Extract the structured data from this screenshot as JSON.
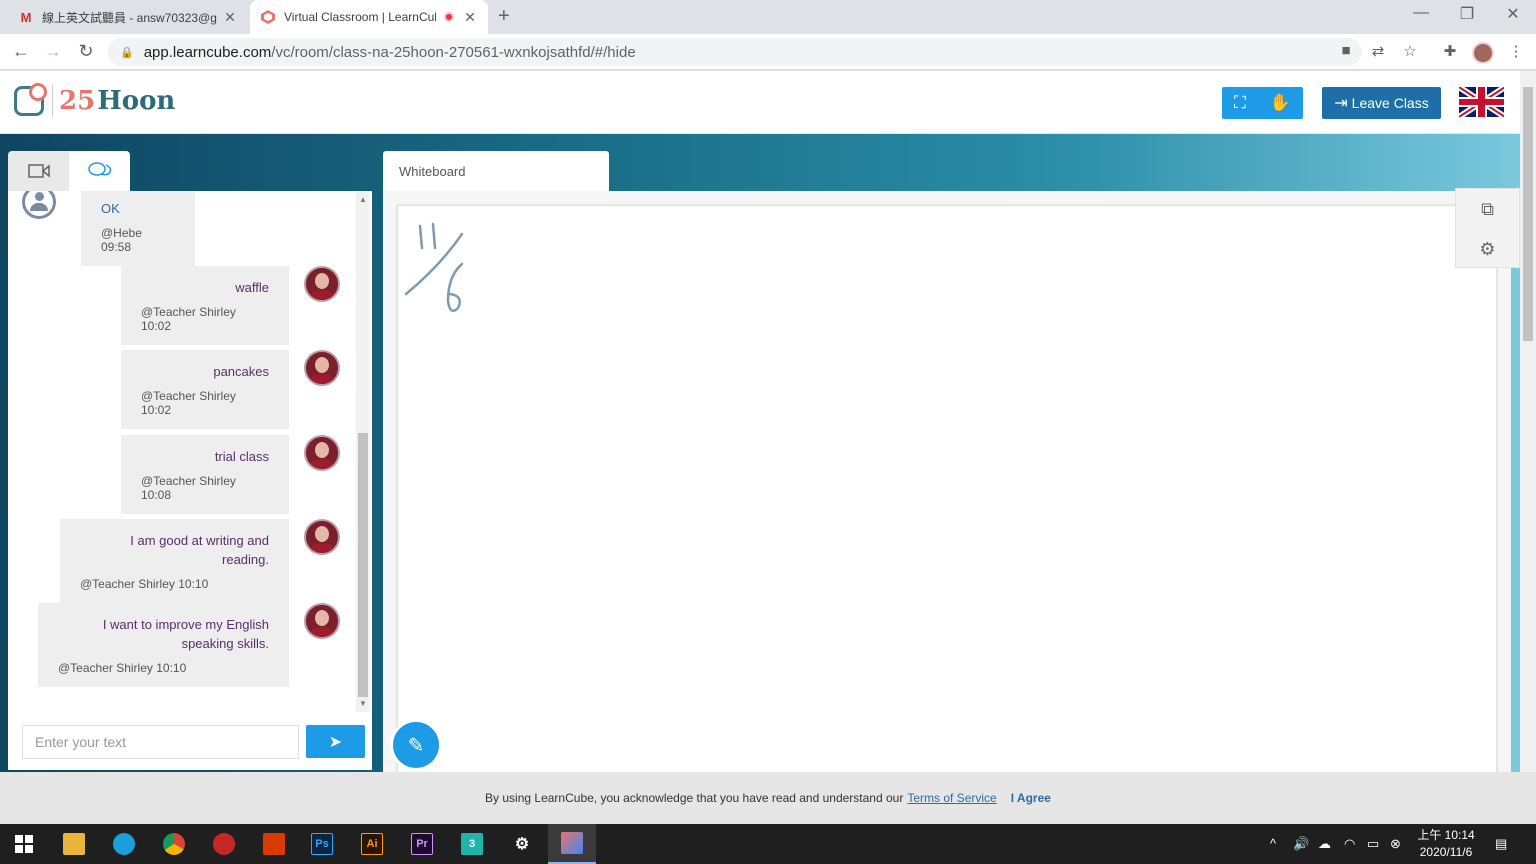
{
  "browser": {
    "tabs": [
      {
        "title": "線上英文試聽員 - answ70323@g",
        "icon": "gmail-icon",
        "active": false
      },
      {
        "title": "Virtual Classroom | LearnCube",
        "icon": "learncube-icon",
        "active": true
      }
    ],
    "url_host": "app.learncube.com",
    "url_path": "/vc/room/class-na-25hoon-270561-wxnkojsathfd/#/hide"
  },
  "app": {
    "logo_num": "25",
    "logo_word": "Hoon",
    "leave_label": "Leave Class",
    "whiteboard_tab": "Whiteboard",
    "chat_placeholder": "Enter your text",
    "messages": [
      {
        "text": "OK",
        "meta": "@Hebe 09:58",
        "from": "student"
      },
      {
        "text": "waffle",
        "meta": "@Teacher Shirley 10:02",
        "from": "teacher"
      },
      {
        "text": "pancakes",
        "meta": "@Teacher Shirley 10:02",
        "from": "teacher"
      },
      {
        "text": "trial class",
        "meta": "@Teacher Shirley 10:08",
        "from": "teacher"
      },
      {
        "text": "I am good at writing and reading.",
        "meta": "@Teacher Shirley 10:10",
        "from": "teacher"
      },
      {
        "text": "I want to improve my English speaking skills.",
        "meta": "@Teacher Shirley 10:10",
        "from": "teacher"
      }
    ]
  },
  "cookie": {
    "text": "By using LearnCube, you acknowledge that you have read and understand our",
    "link": "Terms of Service",
    "agree": "I Agree"
  },
  "taskbar": {
    "time": "上午 10:14",
    "date": "2020/11/6",
    "apps": [
      "Ps",
      "Ai",
      "Pr",
      "3"
    ]
  },
  "colors": {
    "accent": "#1e9be6",
    "leave": "#1e6fa8",
    "ink": "#7d9bb5"
  }
}
